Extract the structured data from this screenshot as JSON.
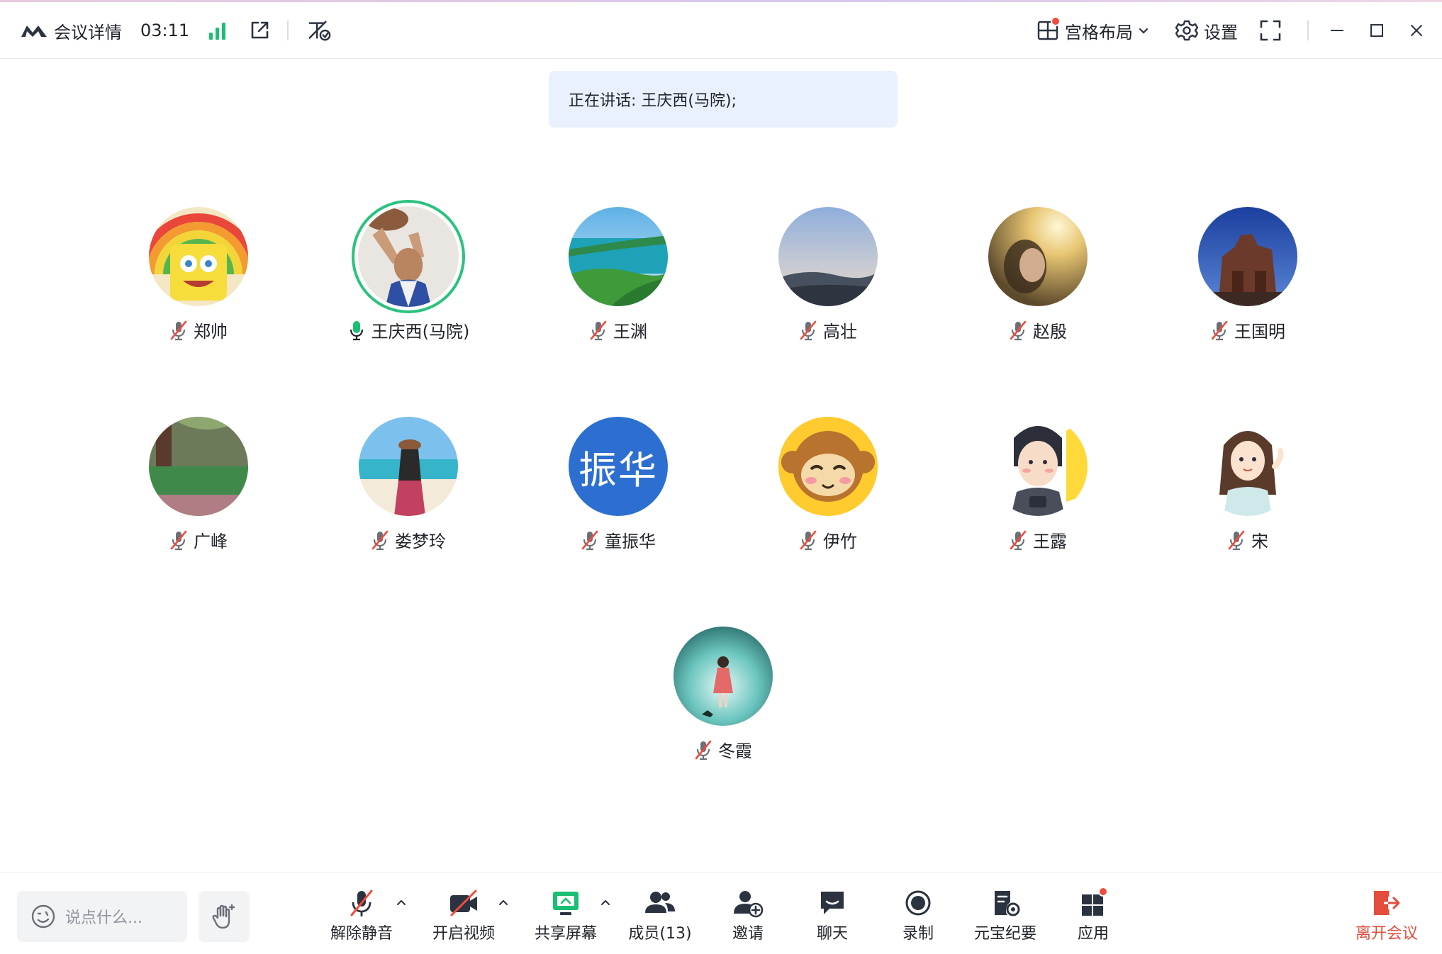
{
  "header": {
    "meeting_info_label": "会议详情",
    "timer": "03:11",
    "layout_label": "宫格布局",
    "settings_label": "设置"
  },
  "banner": {
    "speaking_text": "正在讲话: 王庆西(马院);"
  },
  "participants": [
    {
      "name": "郑帅",
      "muted": true
    },
    {
      "name": "王庆西(马院)",
      "muted": false,
      "speaking": true
    },
    {
      "name": "王渊",
      "muted": true
    },
    {
      "name": "高壮",
      "muted": true
    },
    {
      "name": "赵殷",
      "muted": true
    },
    {
      "name": "王国明",
      "muted": true
    },
    {
      "name": "广峰",
      "muted": true
    },
    {
      "name": "娄梦玲",
      "muted": true
    },
    {
      "name": "童振华",
      "muted": true,
      "avatar_text": "振华"
    },
    {
      "name": "伊竹",
      "muted": true
    },
    {
      "name": "王露",
      "muted": true
    },
    {
      "name": "宋",
      "muted": true
    },
    {
      "name": "冬霞",
      "muted": true
    }
  ],
  "toolbar": {
    "chat_placeholder": "说点什么...",
    "unmute_label": "解除静音",
    "video_label": "开启视频",
    "share_label": "共享屏幕",
    "members_label": "成员(13)",
    "invite_label": "邀请",
    "chat_label": "聊天",
    "record_label": "录制",
    "minutes_label": "元宝纪要",
    "apps_label": "应用",
    "leave_label": "离开会议"
  },
  "colors": {
    "speaking_ring": "#2bc27e",
    "signal": "#1bbf74",
    "leave": "#e34d3c",
    "banner_bg": "#eaf1fe",
    "notification_dot": "#f24b3b",
    "text_avatar_bg": "#2d6fd1"
  },
  "icons": [
    "logo-icon",
    "signal-icon",
    "share-window-icon",
    "no-subtitle-icon",
    "grid-layout-icon",
    "chevron-down-icon",
    "gear-icon",
    "fullscreen-icon",
    "minimize-icon",
    "maximize-icon",
    "close-icon",
    "mic-muted-icon",
    "mic-active-icon",
    "emoji-icon",
    "raise-hand-icon",
    "camera-off-icon",
    "screen-share-icon",
    "members-icon",
    "invite-icon",
    "chat-icon",
    "record-icon",
    "minutes-icon",
    "apps-icon",
    "leave-icon"
  ]
}
